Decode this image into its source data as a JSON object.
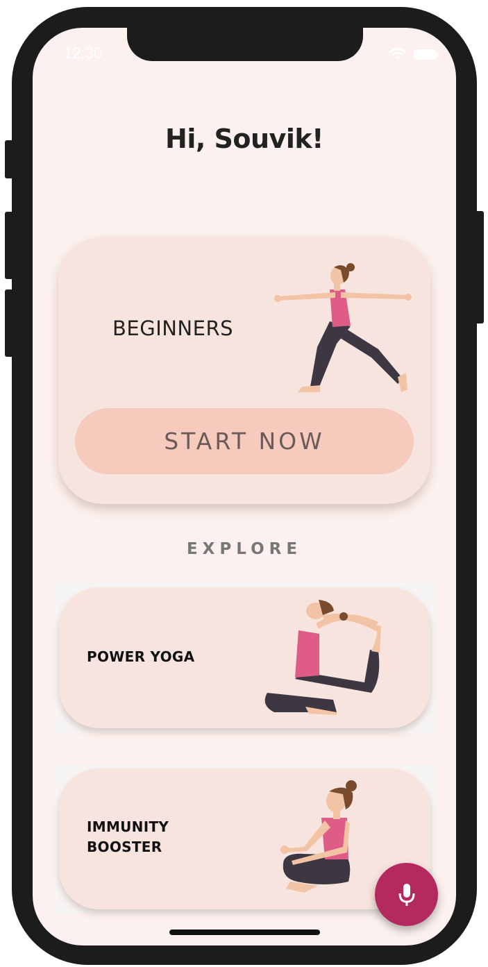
{
  "status_bar": {
    "time": "12:30"
  },
  "greeting": "Hi, Souvik!",
  "hero": {
    "title": "BEGINNERS",
    "button_label": "START NOW"
  },
  "explore_label": "EXPLORE",
  "cards": [
    {
      "title_line1": "POWER YOGA",
      "title_line2": ""
    },
    {
      "title_line1": "IMMUNITY",
      "title_line2": "BOOSTER"
    }
  ],
  "icons": {
    "wifi": "wifi-icon",
    "battery": "battery-icon",
    "mic": "microphone-icon"
  },
  "colors": {
    "screen_bg": "#fcf1ee",
    "card_bg": "#f8e4de",
    "button_bg": "#f6cabd",
    "fab_bg": "#b52a5e",
    "figure_top": "#df5c86",
    "figure_pants": "#3c3740",
    "skin": "#f2c3a5",
    "hair": "#7a4a2c"
  }
}
